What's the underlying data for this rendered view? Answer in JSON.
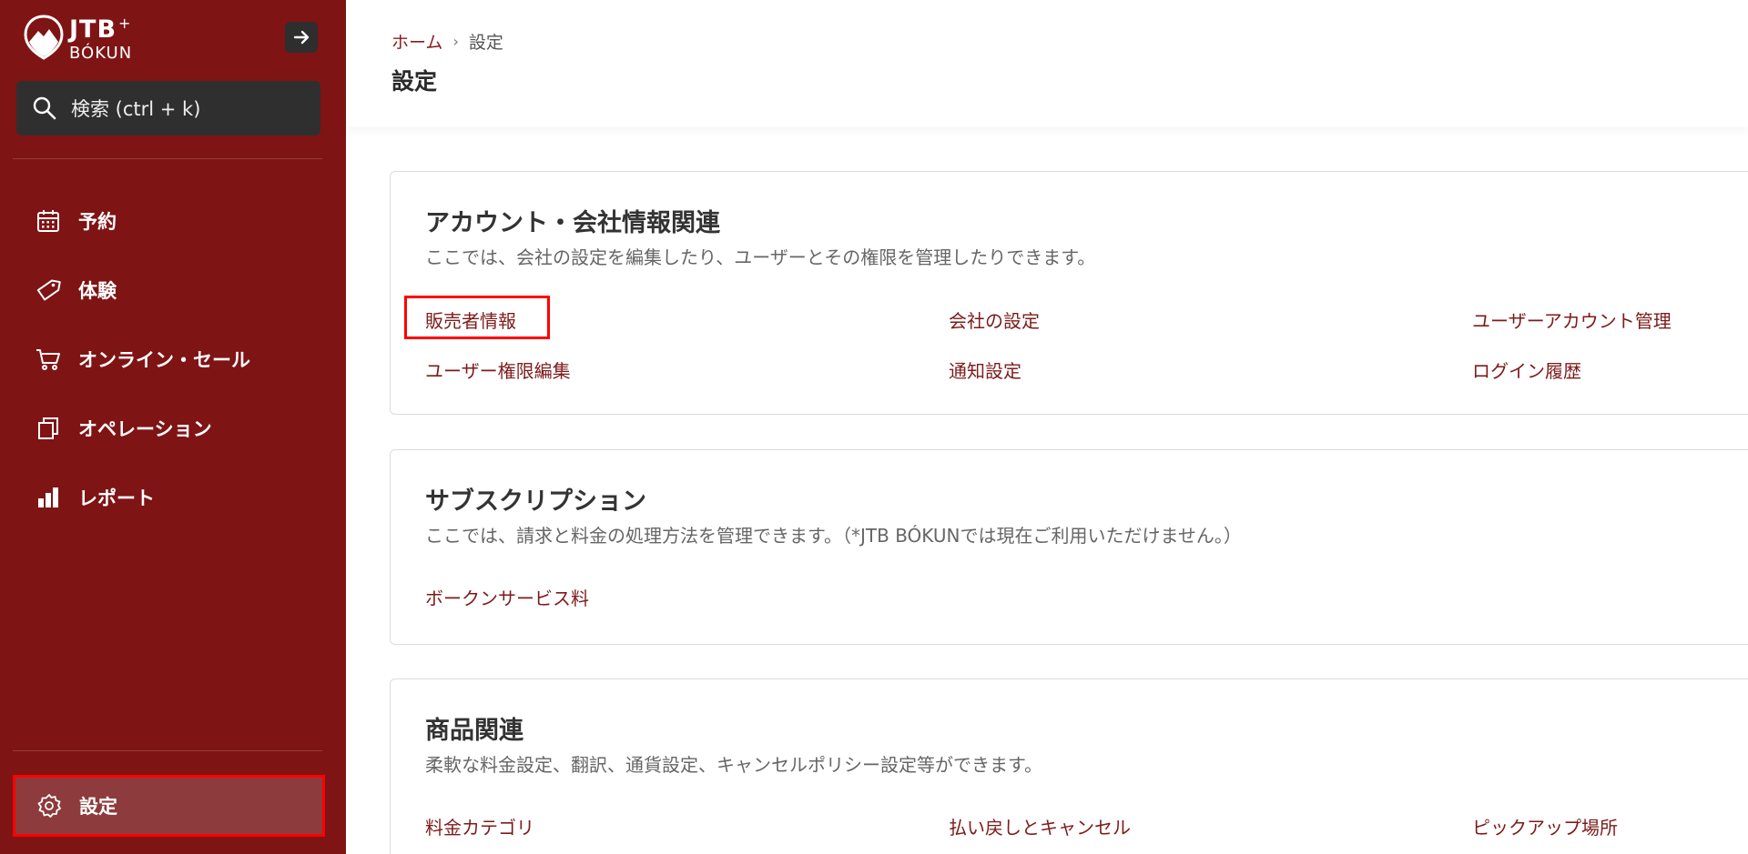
{
  "brand": {
    "name_top": "JTB",
    "plus": "+",
    "name_bottom": "BÓKUN",
    "accent": "#7f1415"
  },
  "sidebar": {
    "search_placeholder": "検索 (ctrl + k)",
    "items": [
      {
        "label": "予約",
        "icon": "calendar-icon"
      },
      {
        "label": "体験",
        "icon": "tag-icon"
      },
      {
        "label": "オンライン・セール",
        "icon": "cart-icon"
      },
      {
        "label": "オペレーション",
        "icon": "copy-icon"
      },
      {
        "label": "レポート",
        "icon": "bar-chart-icon"
      }
    ],
    "settings_label": "設定"
  },
  "header": {
    "breadcrumb": [
      {
        "label": "ホーム"
      },
      {
        "label": "設定"
      }
    ],
    "title": "設定"
  },
  "sections": [
    {
      "title": "アカウント・会社情報関連",
      "description": "ここでは、会社の設定を編集したり、ユーザーとその権限を管理したりできます。",
      "links": [
        "販売者情報",
        "会社の設定",
        "ユーザーアカウント管理",
        "ユーザー権限編集",
        "通知設定",
        "ログイン履歴"
      ]
    },
    {
      "title": "サブスクリプション",
      "description": "ここでは、請求と料金の処理方法を管理できます。（*JTB BÓKUNでは現在ご利用いただけません。）",
      "links": [
        "ボークンサービス料"
      ]
    },
    {
      "title": "商品関連",
      "description": "柔軟な料金設定、翻訳、通貨設定、キャンセルポリシー設定等ができます。",
      "links": [
        "料金カテゴリ",
        "払い戻しとキャンセル",
        "ピックアップ場所"
      ]
    }
  ]
}
